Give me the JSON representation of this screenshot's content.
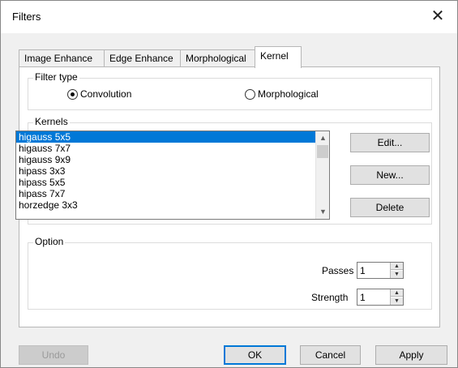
{
  "window": {
    "title": "Filters",
    "close_symbol": "✕"
  },
  "tabs": [
    {
      "label": "Image Enhance",
      "active": false
    },
    {
      "label": "Edge Enhance",
      "active": false
    },
    {
      "label": "Morphological",
      "active": false
    },
    {
      "label": "Kernel",
      "active": true
    }
  ],
  "filter_type": {
    "group_label": "Filter type",
    "options": [
      {
        "label": "Convolution",
        "checked": true
      },
      {
        "label": "Morphological",
        "checked": false
      }
    ]
  },
  "kernels": {
    "group_label": "Kernels",
    "items": [
      "higauss 5x5",
      "higauss 7x7",
      "higauss 9x9",
      "hipass 3x3",
      "hipass 5x5",
      "hipass 7x7",
      "horzedge 3x3"
    ],
    "selected_index": 0,
    "scroll_up": "▲",
    "scroll_down": "▼",
    "edit_label": "Edit...",
    "new_label": "New...",
    "delete_label": "Delete"
  },
  "option": {
    "group_label": "Option",
    "passes_label": "Passes",
    "passes_value": "1",
    "strength_label": "Strength",
    "strength_value": "1",
    "spin_up": "▲",
    "spin_down": "▼"
  },
  "footer": {
    "undo_label": "Undo",
    "ok_label": "OK",
    "cancel_label": "Cancel",
    "apply_label": "Apply"
  }
}
